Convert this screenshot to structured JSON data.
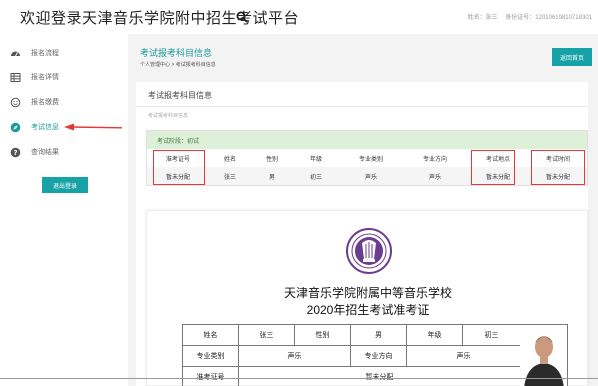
{
  "header": {
    "title": "欢迎登录天津音乐学院附中招生考试平台",
    "search_icon": "search-icon",
    "name_label": "姓名：张三",
    "id_label": "身份证号：12010619810718301"
  },
  "sidebar": {
    "items": [
      {
        "label": "报名流程",
        "icon": "dashboard-icon"
      },
      {
        "label": "报名详情",
        "icon": "table-icon"
      },
      {
        "label": "报名缴费",
        "icon": "smile-icon"
      },
      {
        "label": "考试信息",
        "icon": "compass-icon",
        "active": true
      },
      {
        "label": "查询结果",
        "icon": "question-icon"
      }
    ],
    "logout_label": "退出登录"
  },
  "main": {
    "page_title": "考试报考科目信息",
    "breadcrumb": "个人管理中心 > 考试报考科目信息",
    "back_label": "返回首页",
    "panel_title": "考试报考科目信息",
    "panel_sub": "考试报考科目信息",
    "stage": "考试阶段：初试",
    "table": {
      "headers": [
        "准考证号",
        "姓名",
        "性别",
        "年级",
        "专业类别",
        "专业方向",
        "考试地点",
        "考试时间"
      ],
      "row": [
        "暂未分配",
        "张三",
        "男",
        "初三",
        "声乐",
        "声乐",
        "暂未分配",
        "暂未分配"
      ]
    }
  },
  "ticket": {
    "school": "天津音乐学院附属中等音乐学校",
    "title": "2020年招生考试准考证",
    "row1": [
      "姓名",
      "张三",
      "性别",
      "男",
      "年级",
      "初三"
    ],
    "row2": [
      "专业类别",
      "声乐",
      "专业方向",
      "声乐"
    ],
    "row3": [
      "准考证号",
      "暂未分配"
    ]
  },
  "colors": {
    "accent": "#17a2a8",
    "stage_bg": "#dff0d8",
    "highlight_red": "#e53935"
  }
}
